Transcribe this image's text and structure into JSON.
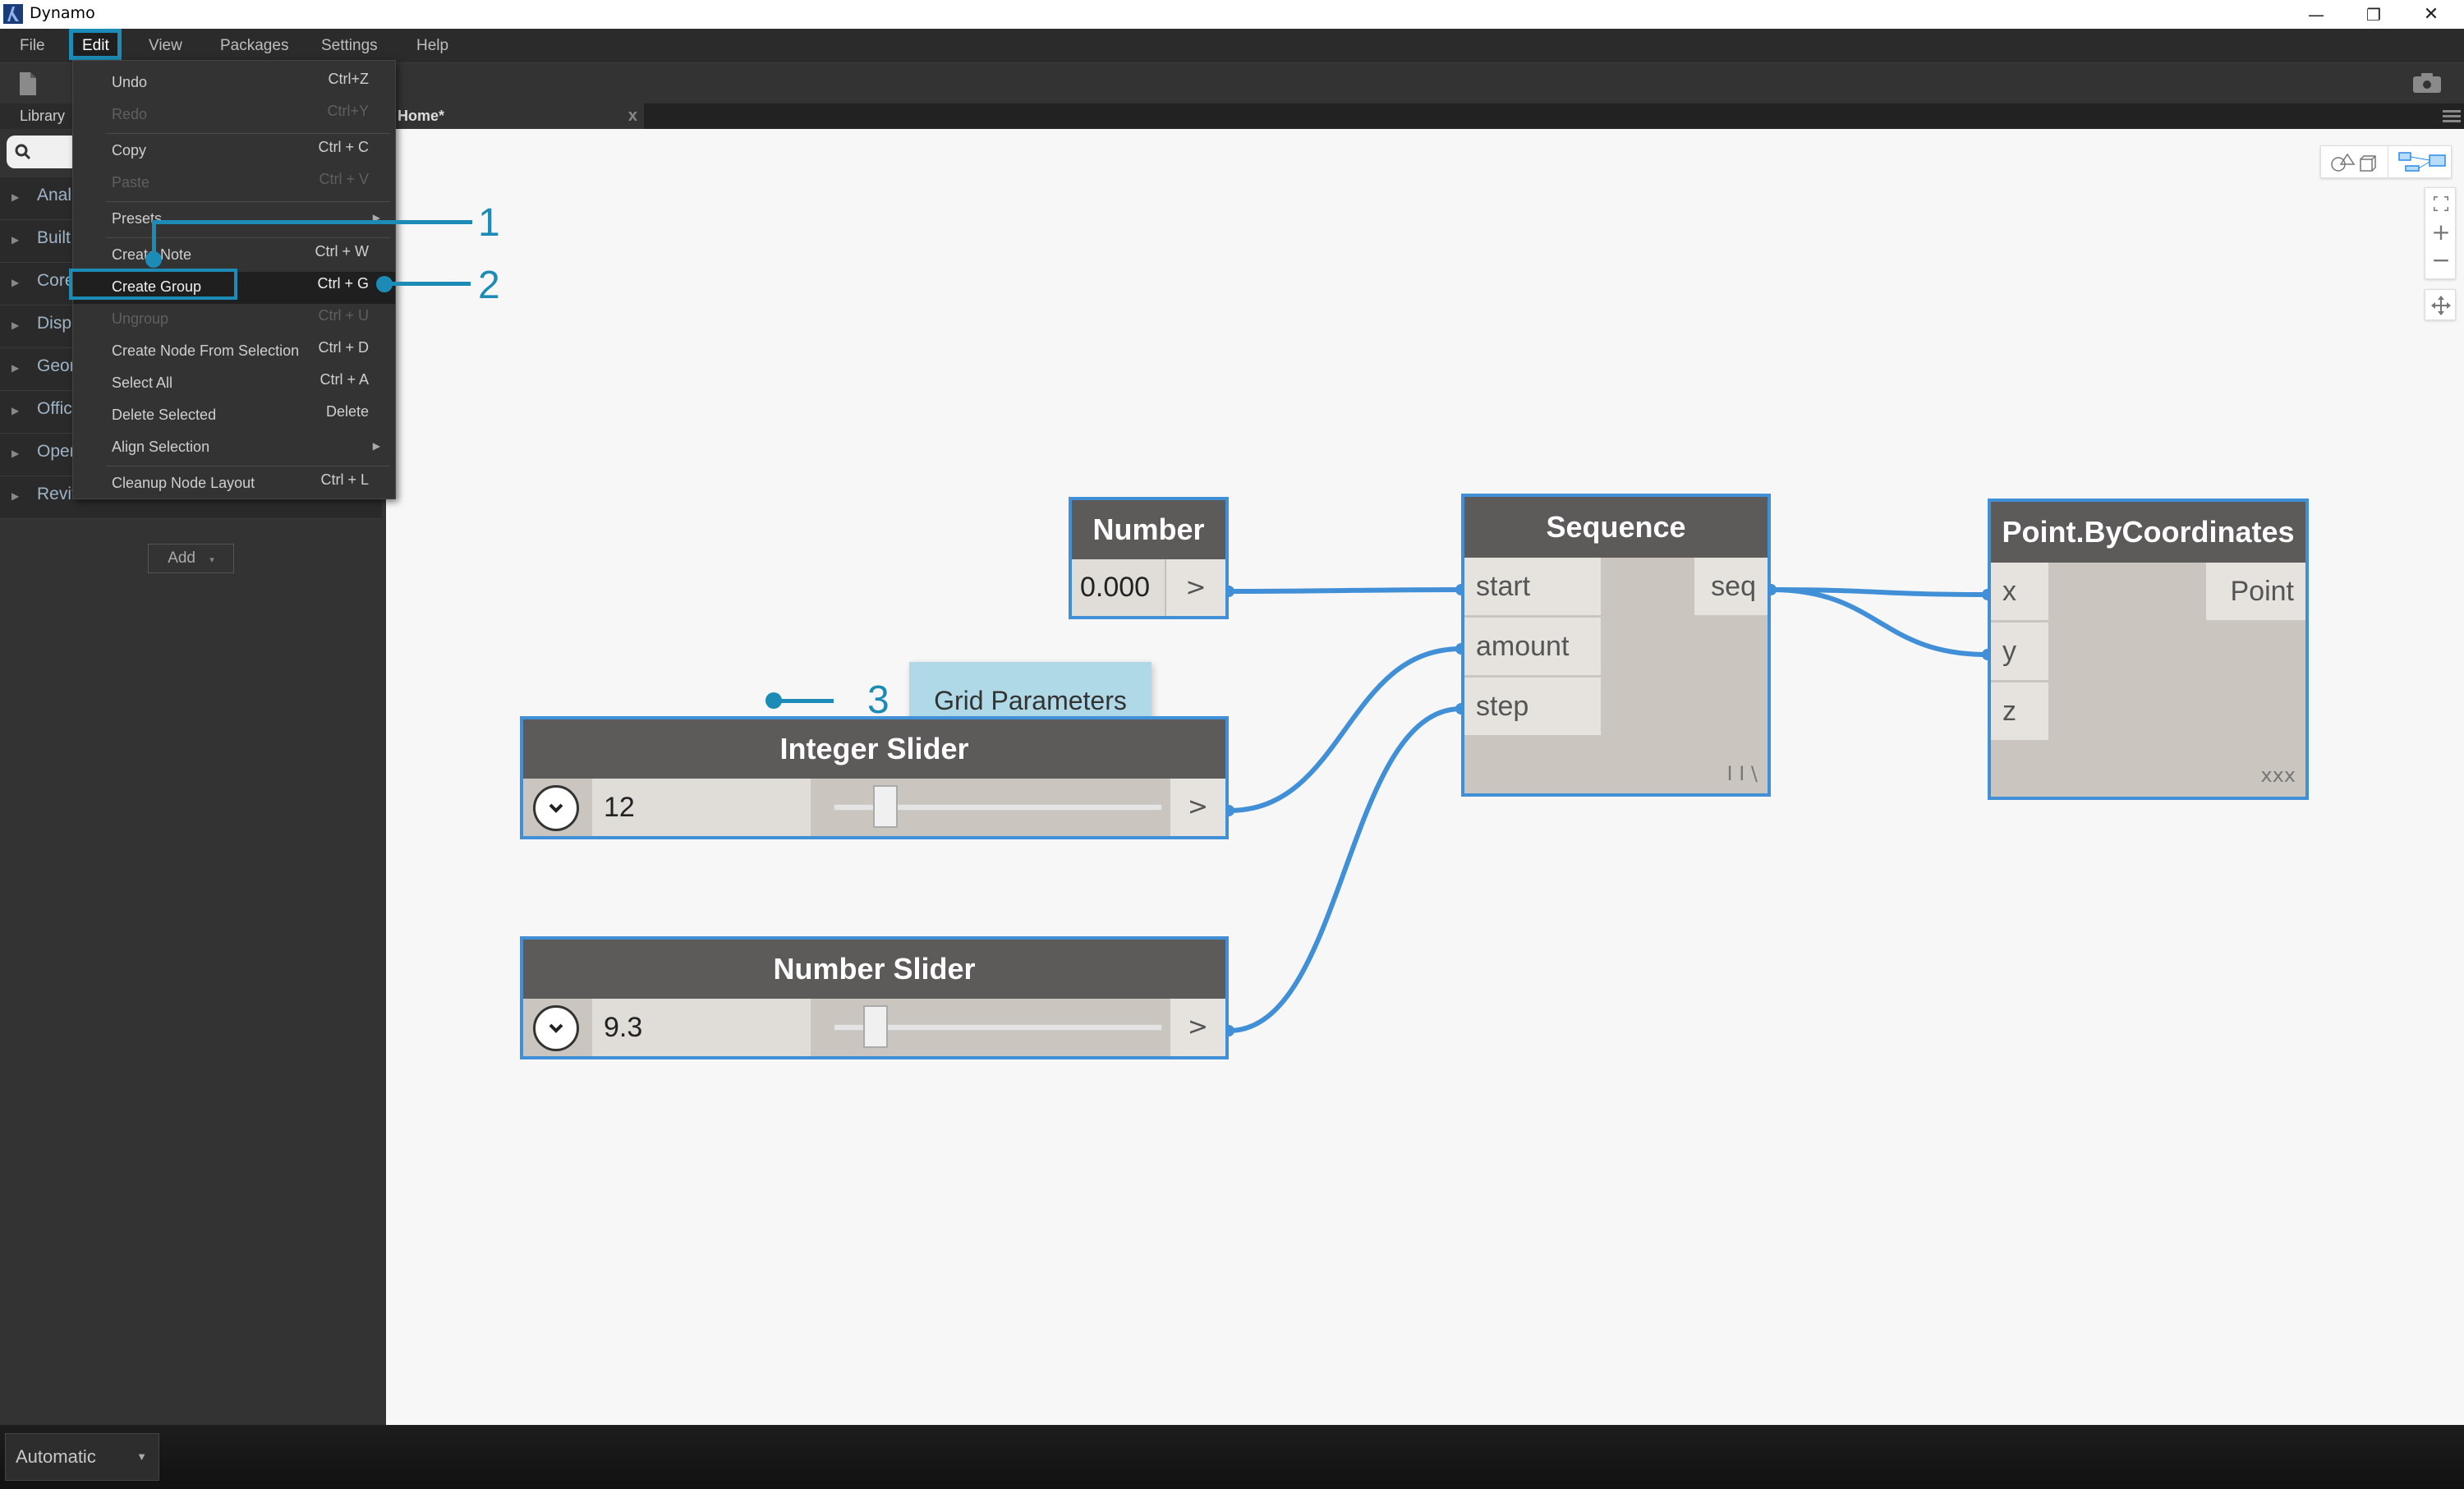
{
  "window": {
    "title": "Dynamo",
    "controls": {
      "minimize": "—",
      "restore": "❐",
      "close": "✕"
    }
  },
  "menubar": {
    "items": [
      {
        "label": "File"
      },
      {
        "label": "Edit",
        "active": true
      },
      {
        "label": "View"
      },
      {
        "label": "Packages"
      },
      {
        "label": "Settings"
      },
      {
        "label": "Help"
      }
    ]
  },
  "tabs": {
    "library": "Library",
    "workspace": "Home*",
    "close": "x"
  },
  "sidebar": {
    "search_placeholder": "",
    "categories": [
      {
        "label": "Anal"
      },
      {
        "label": "Built"
      },
      {
        "label": "Core"
      },
      {
        "label": "Disp"
      },
      {
        "label": "Geor"
      },
      {
        "label": "Offic"
      },
      {
        "label": "Oper"
      },
      {
        "label": "Revit"
      }
    ],
    "add_label": "Add",
    "add_caret": "▾"
  },
  "edit_menu": {
    "items": [
      {
        "label": "Undo",
        "shortcut": "Ctrl+Z",
        "enabled": true
      },
      {
        "label": "Redo",
        "shortcut": "Ctrl+Y",
        "enabled": false
      },
      {
        "separator": true
      },
      {
        "label": "Copy",
        "shortcut": "Ctrl + C",
        "enabled": true
      },
      {
        "label": "Paste",
        "shortcut": "Ctrl + V",
        "enabled": false
      },
      {
        "separator": true
      },
      {
        "label": "Presets",
        "submenu": true,
        "enabled": true
      },
      {
        "separator": true
      },
      {
        "label": "Create Note",
        "shortcut": "Ctrl + W",
        "enabled": true
      },
      {
        "label": "Create Group",
        "shortcut": "Ctrl + G",
        "enabled": true,
        "highlighted": true
      },
      {
        "label": "Ungroup",
        "shortcut": "Ctrl + U",
        "enabled": false
      },
      {
        "label": "Create Node From Selection",
        "shortcut": "Ctrl + D",
        "enabled": true
      },
      {
        "label": "Select All",
        "shortcut": "Ctrl + A",
        "enabled": true
      },
      {
        "label": "Delete Selected",
        "shortcut": "Delete",
        "enabled": true
      },
      {
        "label": "Align Selection",
        "submenu": true,
        "enabled": true
      },
      {
        "separator": true
      },
      {
        "label": "Cleanup Node Layout",
        "shortcut": "Ctrl + L",
        "enabled": true
      }
    ]
  },
  "callouts": [
    {
      "number": "1",
      "target": "Create Note"
    },
    {
      "number": "2",
      "target": "Create Group"
    },
    {
      "number": "3",
      "target": "Grid Parameters"
    }
  ],
  "canvas": {
    "note": {
      "text": "Grid Parameters"
    },
    "nodes": {
      "number": {
        "title": "Number",
        "value": "0.000",
        "output": ">"
      },
      "integer_slider": {
        "title": "Integer Slider",
        "value": "12",
        "output": ">",
        "thumb_fraction": 0.12
      },
      "number_slider": {
        "title": "Number Slider",
        "value": "9.3",
        "output": ">",
        "thumb_fraction": 0.09
      },
      "sequence": {
        "title": "Sequence",
        "inputs": [
          "start",
          "amount",
          "step"
        ],
        "output": "seq",
        "lacing": "I I \\"
      },
      "point": {
        "title": "Point.ByCoordinates",
        "inputs": [
          "x",
          "y",
          "z"
        ],
        "output": "Point",
        "lacing": "xxx"
      }
    },
    "wire_color": "#4190d7"
  },
  "bottombar": {
    "run_mode": "Automatic"
  },
  "colors": {
    "accent": "#1c8bb6",
    "wire": "#4190d7",
    "note_bg": "#afd9e6",
    "node_header": "#5d5b59"
  }
}
